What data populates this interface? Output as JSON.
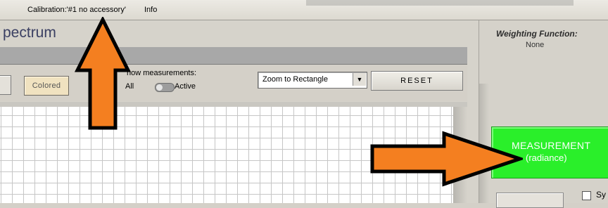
{
  "menubar": {
    "calibration": "Calibration:'#1  no accessory'",
    "info": "Info"
  },
  "main": {
    "title": "pectrum",
    "toolbar": {
      "colored_label": "Colored",
      "show_measurements_label": "how measurements:",
      "all_label": "All",
      "active_label": "Active",
      "zoom_select_value": "Zoom to Rectangle",
      "reset_label": "RESET"
    }
  },
  "right_panel": {
    "weighting_function_label": "Weighting Function:",
    "weighting_function_value": "None",
    "measurement_button": {
      "line1": "MEASUREMENT",
      "line2": "(radiance)",
      "color": "#2aef2a"
    },
    "sync_label": "Sy"
  },
  "annotations": {
    "arrow_color": "#f47f20",
    "arrow_outline": "#000000"
  }
}
